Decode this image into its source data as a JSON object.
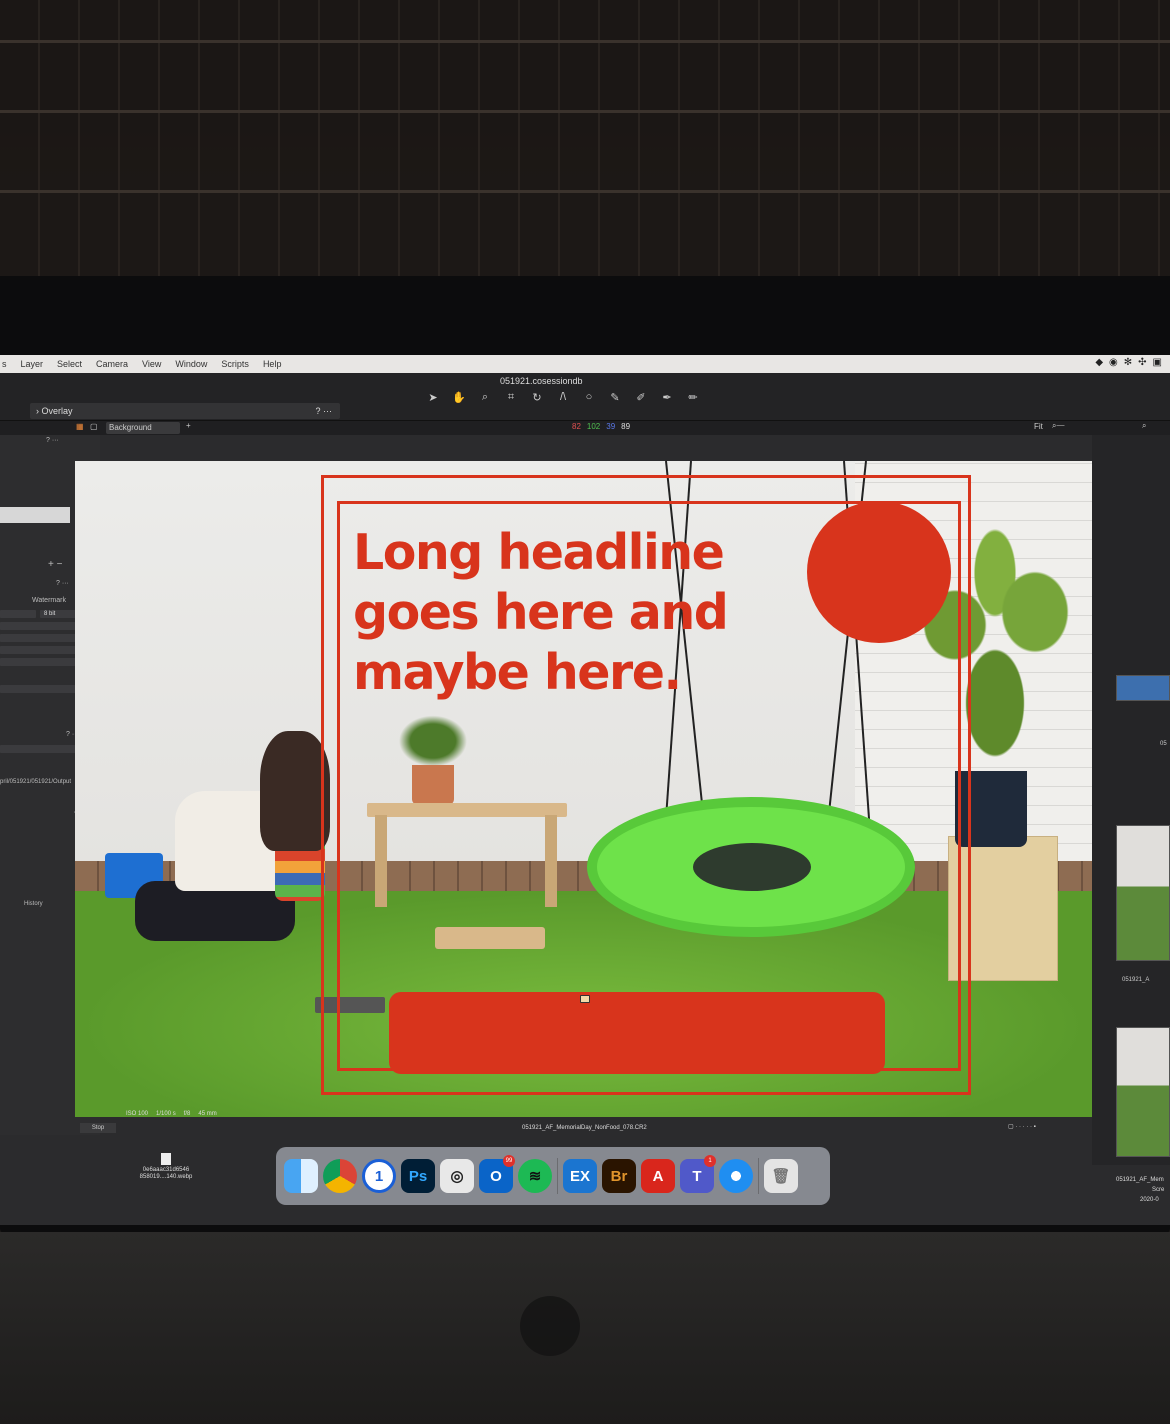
{
  "menubar": {
    "items": [
      "s",
      "Layer",
      "Select",
      "Camera",
      "View",
      "Window",
      "Scripts",
      "Help"
    ]
  },
  "toolbar": {
    "document_title": "051921.cosessiondb",
    "overlay_label": "Overlay",
    "help_label": "? ···"
  },
  "subbar": {
    "layer_select": "Background",
    "readout": {
      "r": "82",
      "g": "102",
      "b": "39",
      "a": "89"
    },
    "zoom_label": "Fit"
  },
  "left_panel": {
    "watermark_label": "Watermark",
    "bit_depth": "8 bit",
    "output_path": "pril/051921/051921/Output",
    "history_label": "History",
    "stop_label": "Stop"
  },
  "overlay": {
    "headline_lines": [
      "Long headline",
      "goes here and",
      "maybe here."
    ]
  },
  "info_bar": {
    "iso": "ISO 100",
    "shutter": "1/100 s",
    "aperture": "f/8",
    "focal_length": "45 mm",
    "filename": "051921_AF_MemorialDay_NonFood_078.CR2"
  },
  "filmstrip": {
    "labels": [
      "051921_A",
      "051921_AF_Mem"
    ],
    "side_text": [
      "05",
      "Scre",
      "2020-0"
    ]
  },
  "desktop": {
    "file_line1": "0e6aaac31d6546",
    "file_line2": "858019....140.webp"
  },
  "dock": {
    "apps": [
      {
        "name": "finder",
        "glyph": ""
      },
      {
        "name": "chrome",
        "glyph": ""
      },
      {
        "name": "1password",
        "glyph": "1"
      },
      {
        "name": "photoshop",
        "glyph": "Ps"
      },
      {
        "name": "capture-one",
        "glyph": "◎"
      },
      {
        "name": "outlook",
        "glyph": "O",
        "badge": "99"
      },
      {
        "name": "spotify",
        "glyph": "≋"
      },
      {
        "name": "exchange",
        "glyph": "EX"
      },
      {
        "name": "bridge",
        "glyph": "Br"
      },
      {
        "name": "acrobat",
        "glyph": "A"
      },
      {
        "name": "teams",
        "glyph": "T",
        "badge": "1"
      },
      {
        "name": "safari",
        "glyph": ""
      },
      {
        "name": "trash",
        "glyph": "🗑"
      }
    ]
  }
}
